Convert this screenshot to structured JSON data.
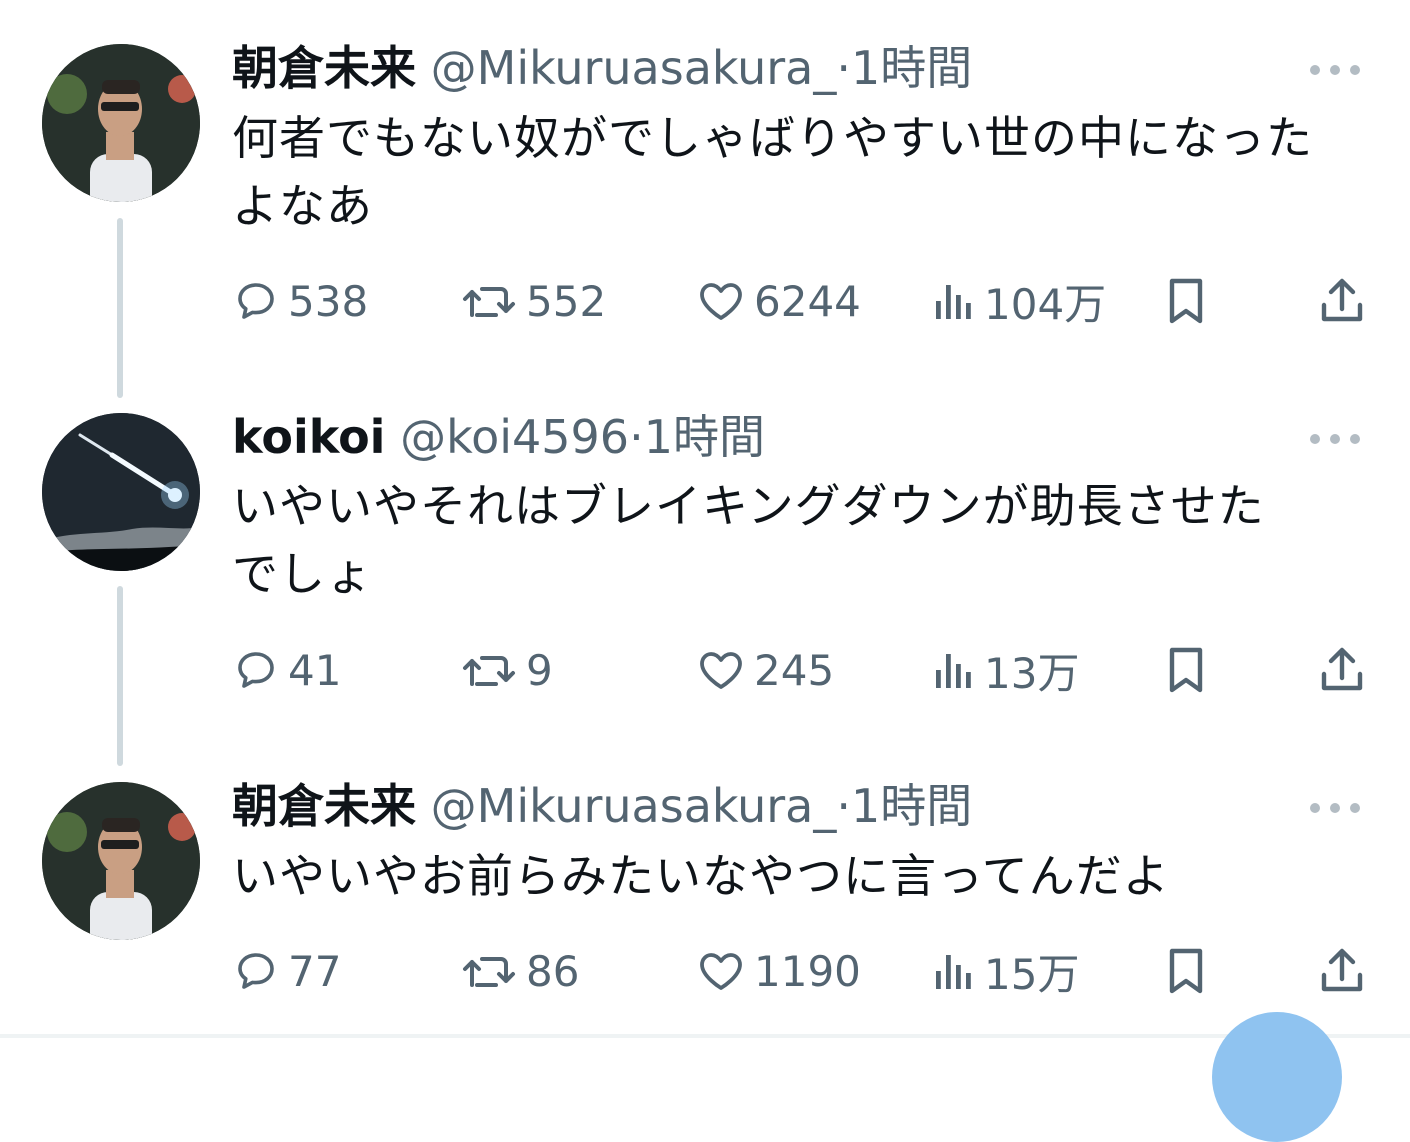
{
  "tweets": [
    {
      "name": "朝倉未来",
      "handle": "@Mikuruasakura_",
      "dot": "·",
      "time": "1時間",
      "lines": [
        "何者でもない奴がでしゃばりやすい世の中になった",
        "よなあ"
      ],
      "replies": "538",
      "retweets": "552",
      "likes": "6244",
      "views": "104万"
    },
    {
      "name": "koikoi",
      "handle": "@koi4596",
      "dot": "·",
      "time": "1時間",
      "lines": [
        "いやいやそれはブレイキングダウンが助長させた",
        "でしょ"
      ],
      "replies": "41",
      "retweets": "9",
      "likes": "245",
      "views": "13万"
    },
    {
      "name": "朝倉未来",
      "handle": "@Mikuruasakura_",
      "dot": "·",
      "time": "1時間",
      "lines": [
        "いやいやお前らみたいなやつに言ってんだよ"
      ],
      "replies": "77",
      "retweets": "86",
      "likes": "1190",
      "views": "15万"
    }
  ],
  "icons": {
    "reply": "speech-bubble-icon",
    "retweet": "retweet-arrows-icon",
    "like": "heart-icon",
    "views": "bar-chart-icon",
    "bookmark": "bookmark-icon",
    "share": "share-upload-icon",
    "more": "ellipsis-icon"
  },
  "colors": {
    "text": "#0f1419",
    "muted": "#536471",
    "thread_line": "#cfd9de",
    "fab": "#8fc3f0"
  }
}
